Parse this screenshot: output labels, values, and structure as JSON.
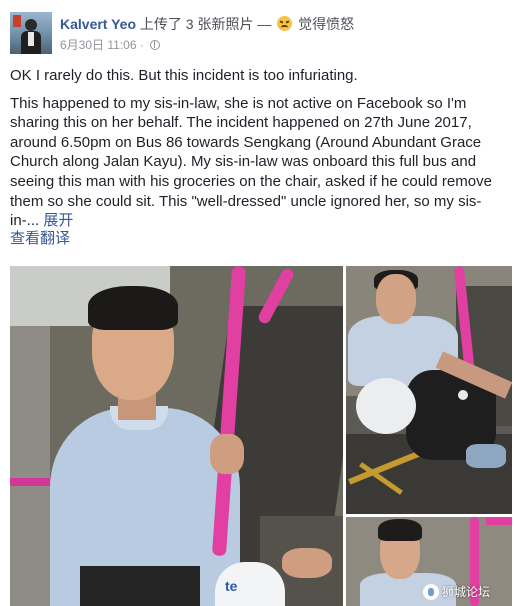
{
  "post": {
    "author": "Kalvert Yeo",
    "action": "上传了 3 张新照片",
    "separator": "—",
    "feeling_icon": "angry-face-icon",
    "feeling": "觉得愤怒",
    "timestamp": "6月30日 11:06",
    "dot": "·",
    "privacy_icon": "globe-icon"
  },
  "body": {
    "paragraph1": "OK I rarely do this. But this incident is too infuriating.",
    "paragraph2": "This happened to my sis-in-law, she is not active on Facebook so I'm sharing this on her behalf. The incident happened on 27th June 2017, around 6.50pm on Bus 86 towards Sengkang (Around Abundant Grace Church along Jalan Kayu). My sis-in-law was onboard this full bus and seeing this man with his groceries on the chair, asked if he could remove them so she could sit. This \"well-dressed\" uncle ignored her, so my sis-in-...",
    "see_more": "展开",
    "translate": "查看翻译"
  },
  "photos": {
    "count": 3,
    "bag_text": "te"
  },
  "watermark": {
    "text": "狮城论坛",
    "icon": "forum-logo-icon"
  },
  "colors": {
    "link": "#365899",
    "pole": "#e23fa3",
    "text": "#1d2129",
    "meta": "#90949c"
  }
}
